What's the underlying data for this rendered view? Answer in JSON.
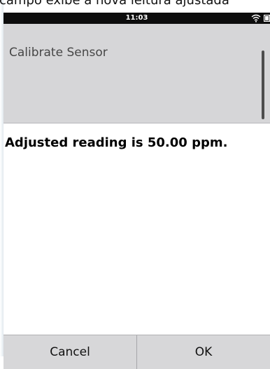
{
  "background_text": "campo exibe a nova leitura ajustada",
  "status_bar": {
    "time": "11:03",
    "icons": [
      "wifi-icon",
      "battery-icon"
    ],
    "background_color": "#0d0d0d"
  },
  "dialog": {
    "title": "Calibrate Sensor",
    "header_color": "#d6d6d8",
    "message": "Adjusted reading is 50.00 ppm."
  },
  "buttons": {
    "cancel_label": "Cancel",
    "ok_label": "OK",
    "bar_color": "#d7d7d9"
  }
}
